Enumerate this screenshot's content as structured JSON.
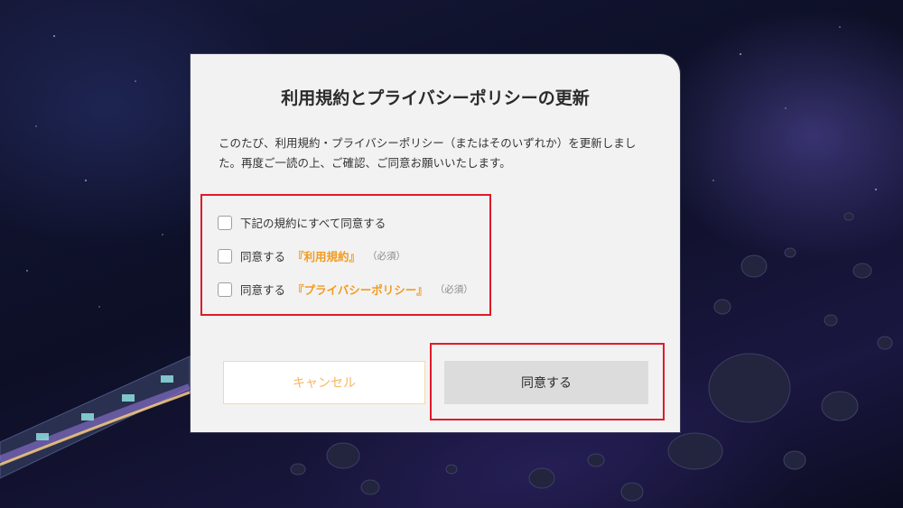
{
  "modal": {
    "title": "利用規約とプライバシーポリシーの更新",
    "description": "このたび、利用規約・プライバシーポリシー（またはそのいずれか）を更新しました。再度ご一読の上、ご確認、ご同意お願いいたします。",
    "checks": {
      "all_label": "下記の規約にすべて同意する",
      "terms_prefix": "同意する",
      "terms_link": "『利用規約』",
      "privacy_prefix": "同意する",
      "privacy_link": "『プライバシーポリシー』",
      "required": "（必須）"
    },
    "buttons": {
      "cancel": "キャンセル",
      "agree": "同意する"
    }
  },
  "colors": {
    "accent": "#f39b1f",
    "highlight": "#e0192a"
  }
}
